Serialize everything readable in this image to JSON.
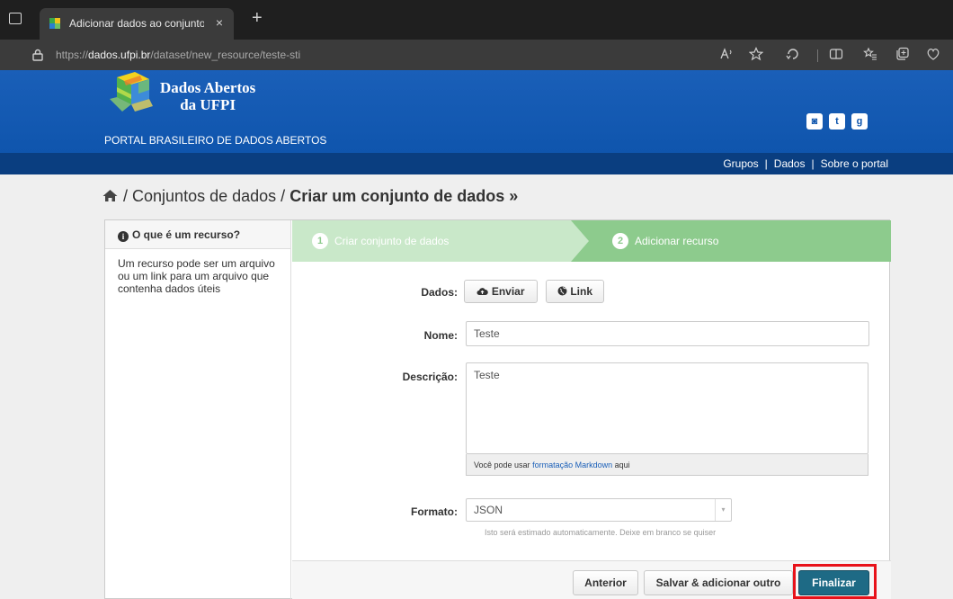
{
  "browser": {
    "tab_title": "Adicionar dados ao conjunto de d",
    "close_glyph": "×",
    "new_tab_glyph": "+",
    "url_prefix": "https://",
    "url_host": "dados.ufpi.br",
    "url_path": "/dataset/new_resource/teste-sti"
  },
  "site": {
    "name_line1": "Dados Abertos",
    "name_line2": "da UFPI",
    "subtitle": "PORTAL BRASILEIRO DE DADOS ABERTOS",
    "nav": [
      "Grupos",
      "Dados",
      "Sobre o portal"
    ],
    "nav_separator": "|",
    "social": {
      "rss": "◙",
      "twitter": "t",
      "github": "g"
    },
    "brand_color": "#1a5fb8"
  },
  "breadcrumb": {
    "sep1": "/",
    "datasets": "Conjuntos de dados",
    "sep2": "/",
    "current": "Criar um conjunto de dados »"
  },
  "sidebar": {
    "info_glyph": "i",
    "title": "O que é um recurso?",
    "body": "Um recurso pode ser um arquivo ou um link para um arquivo que contenha dados úteis"
  },
  "steps": [
    {
      "num": "1",
      "label": "Criar conjunto de dados"
    },
    {
      "num": "2",
      "label": "Adicionar recurso"
    }
  ],
  "form": {
    "dados_label": "Dados:",
    "upload_label": "Enviar",
    "link_label": "Link",
    "nome_label": "Nome:",
    "nome_value": "Teste",
    "descricao_label": "Descrição:",
    "descricao_value": "Teste",
    "markdown_before": "Você pode usar",
    "markdown_link": "formatação Markdown",
    "markdown_after": "aqui",
    "formato_label": "Formato:",
    "formato_value": "JSON",
    "select_arrow": "▾",
    "formato_hint": "Isto será estimado automaticamente. Deixe em branco se quiser"
  },
  "actions": {
    "previous": "Anterior",
    "save_add": "Salvar & adicionar outro",
    "finish": "Finalizar"
  }
}
